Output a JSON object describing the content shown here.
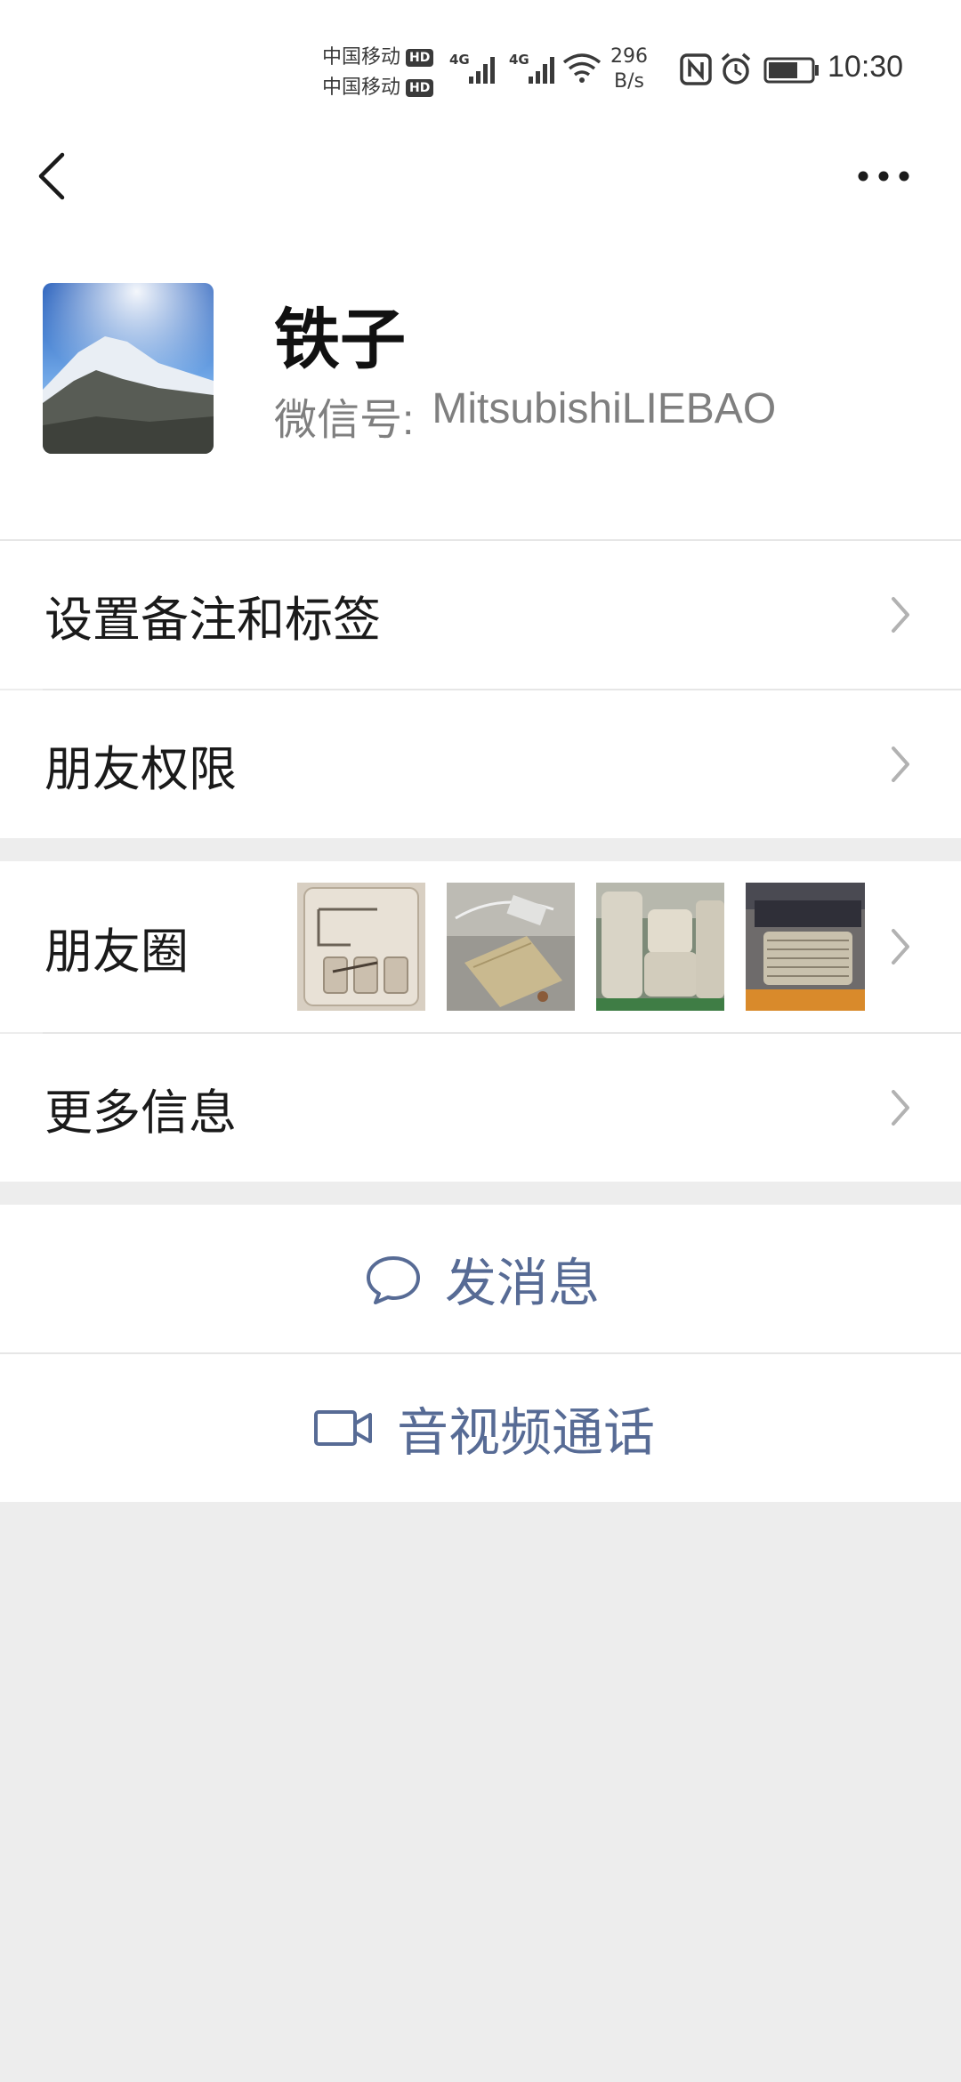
{
  "status_bar": {
    "carrier_1": "中国移动",
    "carrier_2": "中国移动",
    "hd_badge": "HD",
    "network_1": "4G",
    "network_2": "4G",
    "speed_value": "296",
    "speed_unit": "B/s",
    "time": "10:30",
    "battery_level": 0.7
  },
  "nav": {
    "back_icon": "chevron-left-icon",
    "more_icon": "ellipsis-icon"
  },
  "profile": {
    "name": "铁子",
    "wechat_id_label": "微信号:",
    "wechat_id": "MitsubishiLIEBAO"
  },
  "menu": {
    "remark_tags": "设置备注和标签",
    "friend_permissions": "朋友权限",
    "moments": "朋友圈",
    "more_info": "更多信息"
  },
  "actions": {
    "send_message": "发消息",
    "video_call": "音视频通话"
  },
  "colors": {
    "link_blue": "#576b95",
    "background_gray": "#ededed"
  }
}
